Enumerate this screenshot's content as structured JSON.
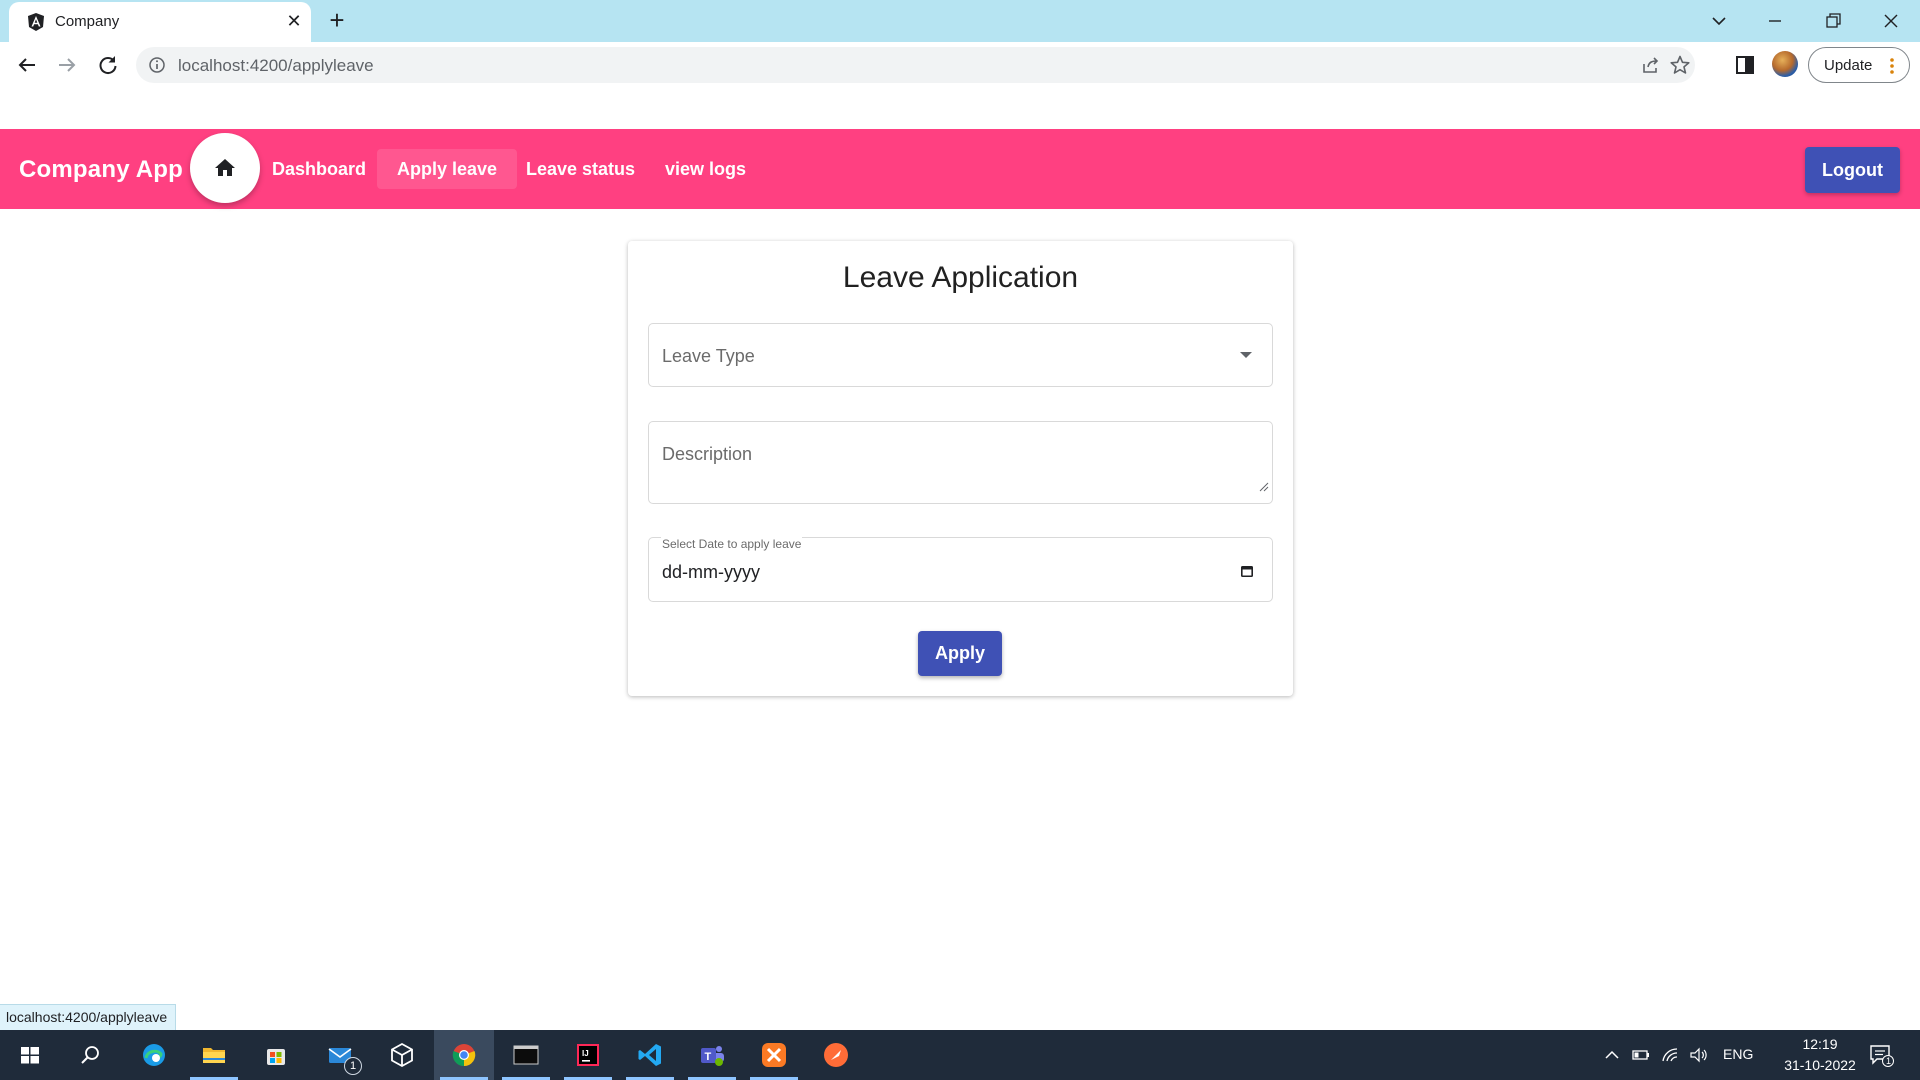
{
  "browser": {
    "tab_title": "Company",
    "url": "localhost:4200/applyleave",
    "update_label": "Update",
    "status_url": "localhost:4200/applyleave"
  },
  "app": {
    "brand": "Company App .",
    "nav": [
      {
        "label": "Dashboard",
        "active": false
      },
      {
        "label": "Apply leave",
        "active": true
      },
      {
        "label": "Leave status",
        "active": false
      },
      {
        "label": "view logs",
        "active": false
      }
    ],
    "logout_label": "Logout",
    "primary_color": "#ff4081",
    "accent_color": "#3f51b5"
  },
  "form": {
    "title": "Leave Application",
    "leave_type_placeholder": "Leave Type",
    "description_placeholder": "Description",
    "date_label": "Select Date to apply leave",
    "date_value": "dd-mm-yyyy",
    "apply_label": "Apply"
  },
  "taskbar": {
    "apps": [
      "windows-start",
      "search",
      "edge",
      "file-explorer",
      "microsoft-store",
      "mail",
      "dev-tool",
      "chrome",
      "terminal",
      "intellij",
      "vscode",
      "teams",
      "xampp",
      "postman"
    ],
    "mail_badge": "1",
    "language": "ENG",
    "time": "12:19",
    "date": "31-10-2022",
    "notification_count": "1"
  }
}
